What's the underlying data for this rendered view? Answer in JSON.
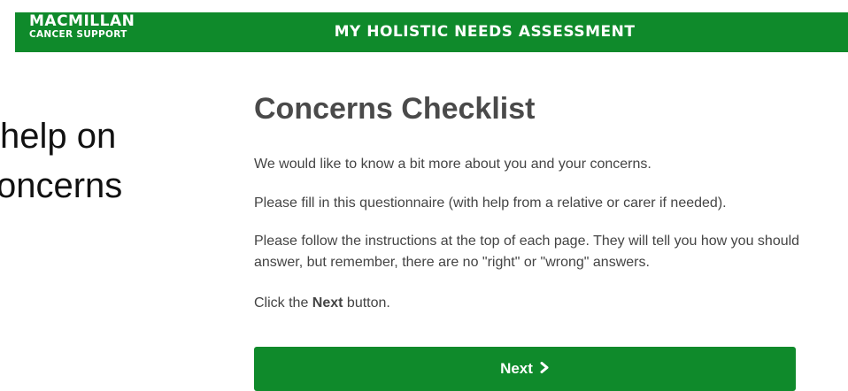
{
  "header": {
    "logo_line1": "MACMILLAN",
    "logo_line2": "CANCER SUPPORT",
    "title": "MY HOLISTIC NEEDS ASSESSMENT",
    "color": "#0f8a2b"
  },
  "side_text": {
    "line1": "help on",
    "line2": "oncerns"
  },
  "main": {
    "title": "Concerns Checklist",
    "paragraph1": "We would like to know a bit more about you and your concerns.",
    "paragraph2": "Please fill in this questionnaire (with help from a relative or carer if needed).",
    "paragraph3": "Please follow the instructions at the top of each page. They will tell you how you should answer, but remember, there are no \"right\" or \"wrong\" answers.",
    "paragraph4_prefix": "Click the ",
    "paragraph4_bold": "Next",
    "paragraph4_suffix": " button.",
    "next_label": "Next",
    "next_icon": "chevron-right-icon"
  }
}
